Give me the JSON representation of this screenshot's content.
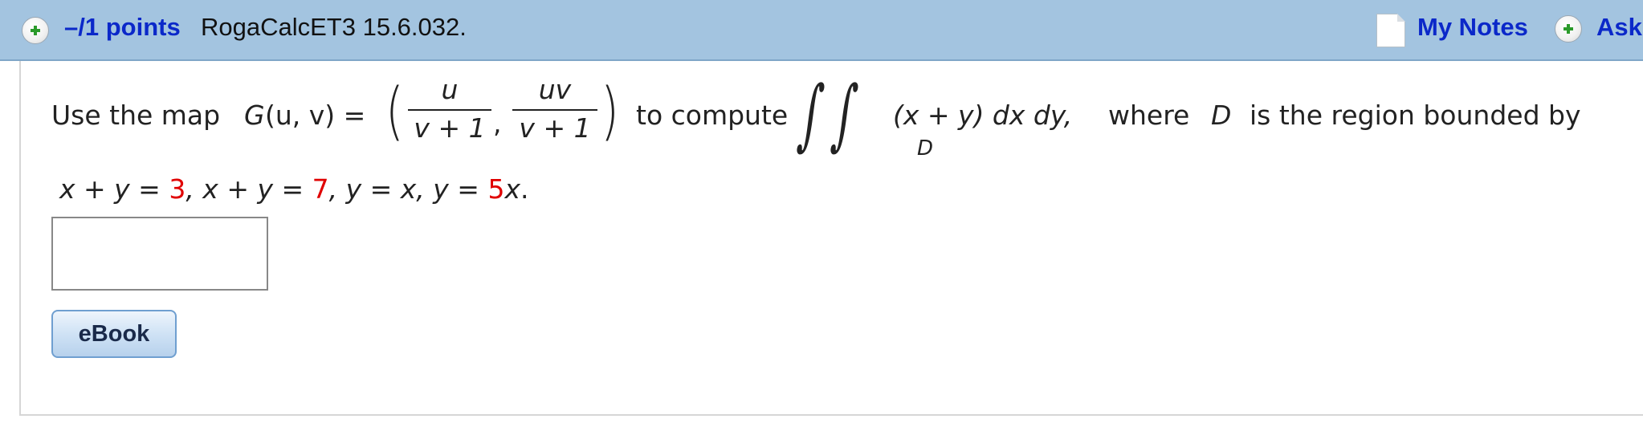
{
  "header": {
    "points_label": "–/1 points",
    "problem_id": "RogaCalcET3 15.6.032.",
    "my_notes_label": "My Notes",
    "ask_label": "Ask",
    "icons": [
      "plus-circle-icon",
      "document-icon",
      "plus-circle-icon"
    ],
    "colors": {
      "bar": "#a3c4e0",
      "link": "#0b28c9",
      "plus": "#2a9a2a"
    }
  },
  "question": {
    "intro": "Use the map",
    "G": "G",
    "G_args": "(u, v) =",
    "frac1_num": "u",
    "frac1_den": "v + 1",
    "comma": ",",
    "frac2_num": "uv",
    "frac2_den": "v + 1",
    "to_compute": "to compute",
    "integrand": "(x + y) dx dy,",
    "region_sub": "D",
    "where": "where",
    "region": "D",
    "bounded": "is the region bounded by",
    "bound1_lhs": "x + y = ",
    "bound1_value": "3",
    "bound2_lhs": ", x + y = ",
    "bound2_value": "7",
    "bound3": ", y = x, y = ",
    "bound4_value": "5",
    "bound4_tail": "x",
    "period": ".",
    "highlight_color": "#e00000"
  },
  "answer": {
    "value": "",
    "placeholder": ""
  },
  "ebook": {
    "label": "eBook"
  }
}
